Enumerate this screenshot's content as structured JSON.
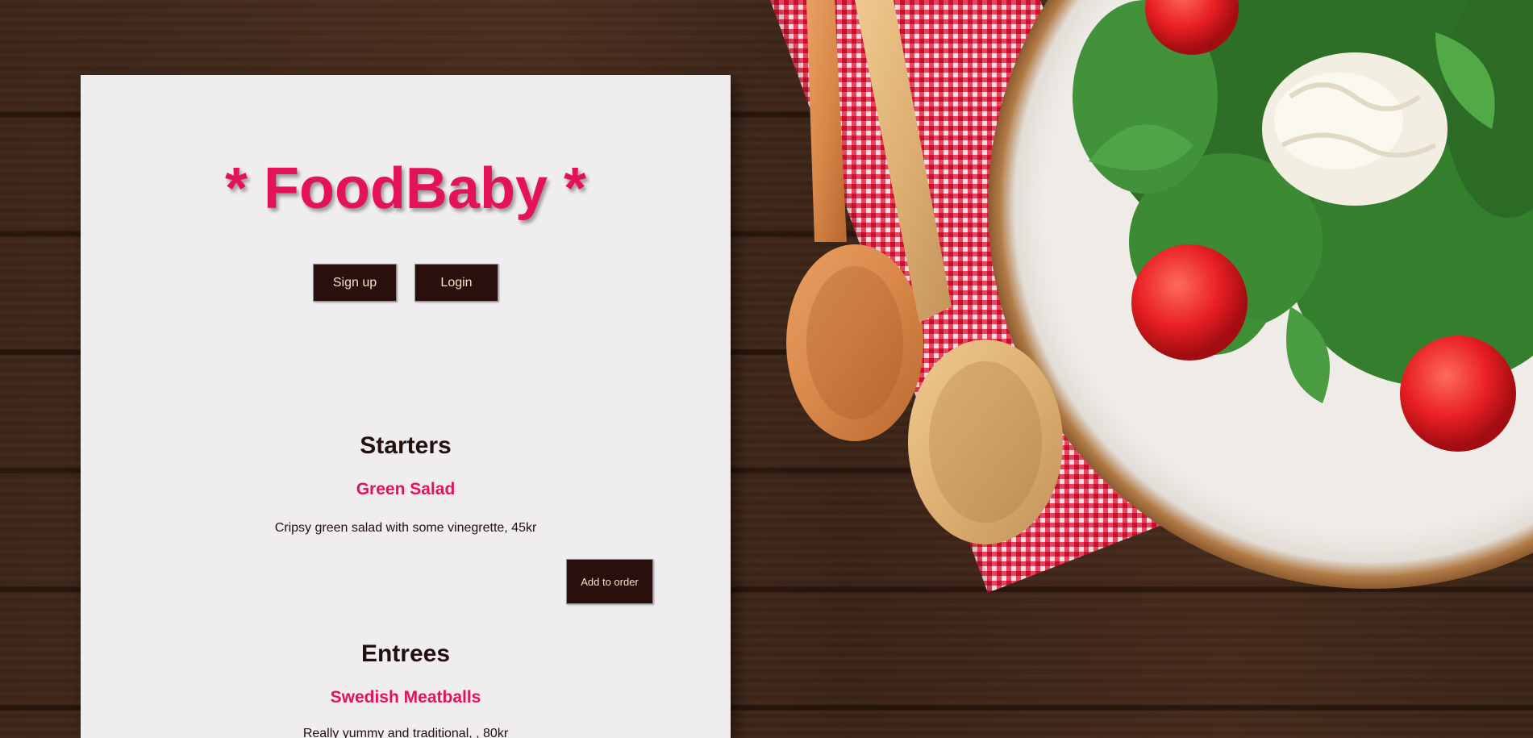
{
  "brand": {
    "title": "* FoodBaby *"
  },
  "auth": {
    "signup_label": "Sign up",
    "login_label": "Login"
  },
  "menu": {
    "sections": [
      {
        "heading": "Starters",
        "dish": {
          "name": "Green Salad",
          "description": "Cripsy green salad with some vinegrette, 45kr",
          "order_label": "Add to order"
        }
      },
      {
        "heading": "Entrees",
        "dish": {
          "name": "Swedish Meatballs",
          "description": "Really yummy and traditional, , 80kr"
        }
      }
    ]
  },
  "colors": {
    "accent": "#e3125b",
    "button_bg": "#2a100d",
    "button_text": "#f4e3c8",
    "panel_bg": "#efedf0",
    "text_dark": "#230f0c",
    "wood": "#3d2619"
  },
  "background": {
    "image_subject": "salad-plate-with-wooden-spoons-on-checkered-napkin"
  }
}
